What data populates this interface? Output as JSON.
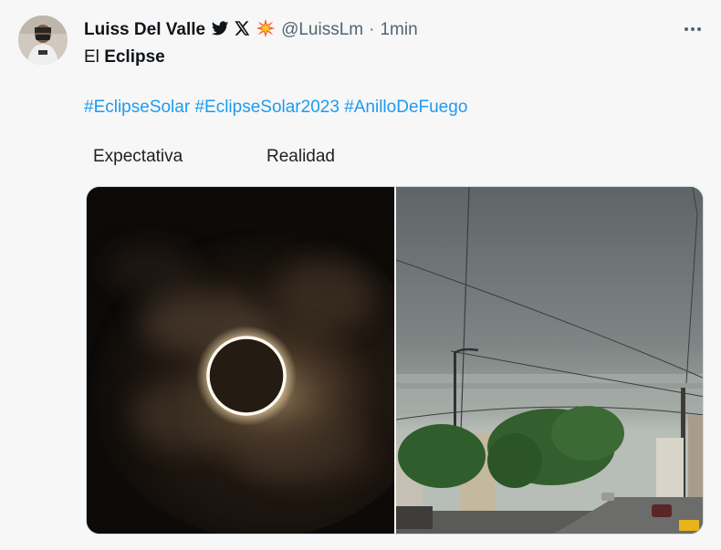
{
  "author": {
    "name": "Luiss Del Valle",
    "badges": [
      "bird-icon",
      "x-logo-icon",
      "explosion-icon"
    ],
    "handle": "@LuissLm",
    "separator": "·",
    "time": "1min"
  },
  "tweet": {
    "text_prefix": "El",
    "text_bold": "Eclipse",
    "hashtags": [
      "#EclipseSolar",
      "#EclipseSolar2023",
      "#AnilloDeFuego"
    ]
  },
  "captions": {
    "left": "Expectativa",
    "right": "Realidad"
  },
  "colors": {
    "link": "#1d9bf0",
    "muted": "#536471",
    "background": "#f7f7f7"
  }
}
